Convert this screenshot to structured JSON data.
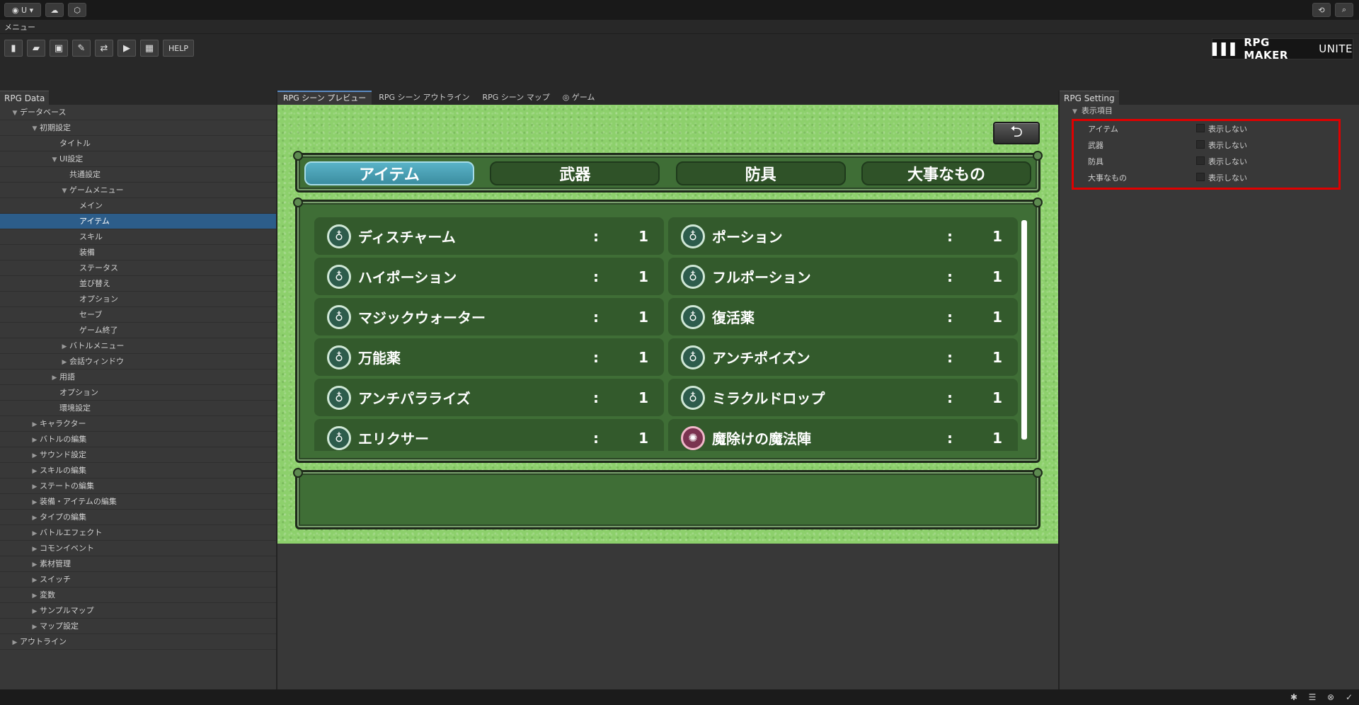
{
  "topbar": {
    "account_label": "U",
    "account_caret": "▾"
  },
  "menu": {
    "label": "メニュー"
  },
  "toolbar": {
    "help_label": "HELP",
    "logo_text": "RPG MAKER",
    "logo_suffix": "UNITE"
  },
  "left_panel": {
    "tab": "RPG Data",
    "tree": [
      {
        "label": "データベース",
        "depth": 0,
        "arrow": "down"
      },
      {
        "label": "初期設定",
        "depth": 2,
        "arrow": "down"
      },
      {
        "label": "タイトル",
        "depth": 4,
        "arrow": "none"
      },
      {
        "label": "UI設定",
        "depth": 4,
        "arrow": "down"
      },
      {
        "label": "共通設定",
        "depth": 5,
        "arrow": "none"
      },
      {
        "label": "ゲームメニュー",
        "depth": 5,
        "arrow": "down"
      },
      {
        "label": "メイン",
        "depth": 6,
        "arrow": "none"
      },
      {
        "label": "アイテム",
        "depth": 6,
        "arrow": "none",
        "selected": true
      },
      {
        "label": "スキル",
        "depth": 6,
        "arrow": "none"
      },
      {
        "label": "装備",
        "depth": 6,
        "arrow": "none"
      },
      {
        "label": "ステータス",
        "depth": 6,
        "arrow": "none"
      },
      {
        "label": "並び替え",
        "depth": 6,
        "arrow": "none"
      },
      {
        "label": "オプション",
        "depth": 6,
        "arrow": "none"
      },
      {
        "label": "セーブ",
        "depth": 6,
        "arrow": "none"
      },
      {
        "label": "ゲーム終了",
        "depth": 6,
        "arrow": "none"
      },
      {
        "label": "バトルメニュー",
        "depth": 5,
        "arrow": "right"
      },
      {
        "label": "会話ウィンドウ",
        "depth": 5,
        "arrow": "right"
      },
      {
        "label": "用語",
        "depth": 4,
        "arrow": "right"
      },
      {
        "label": "オプション",
        "depth": 4,
        "arrow": "none"
      },
      {
        "label": "環境設定",
        "depth": 4,
        "arrow": "none"
      },
      {
        "label": "キャラクター",
        "depth": 2,
        "arrow": "right"
      },
      {
        "label": "バトルの編集",
        "depth": 2,
        "arrow": "right"
      },
      {
        "label": "サウンド設定",
        "depth": 2,
        "arrow": "right"
      },
      {
        "label": "スキルの編集",
        "depth": 2,
        "arrow": "right"
      },
      {
        "label": "ステートの編集",
        "depth": 2,
        "arrow": "right"
      },
      {
        "label": "装備・アイテムの編集",
        "depth": 2,
        "arrow": "right"
      },
      {
        "label": "タイプの編集",
        "depth": 2,
        "arrow": "right"
      },
      {
        "label": "バトルエフェクト",
        "depth": 2,
        "arrow": "right"
      },
      {
        "label": "コモンイベント",
        "depth": 2,
        "arrow": "right"
      },
      {
        "label": "素材管理",
        "depth": 2,
        "arrow": "right"
      },
      {
        "label": "スイッチ",
        "depth": 2,
        "arrow": "right"
      },
      {
        "label": "変数",
        "depth": 2,
        "arrow": "right"
      },
      {
        "label": "サンプルマップ",
        "depth": 2,
        "arrow": "right"
      },
      {
        "label": "マップ設定",
        "depth": 2,
        "arrow": "right"
      },
      {
        "label": "アウトライン",
        "depth": 0,
        "arrow": "right"
      }
    ]
  },
  "center_tabs": [
    {
      "label": "RPG シーン プレビュー",
      "active": true
    },
    {
      "label": "RPG シーン アウトライン",
      "active": false
    },
    {
      "label": "RPG シーン マップ",
      "active": false
    },
    {
      "label": "ゲーム",
      "active": false,
      "icon": "gamepad-icon"
    }
  ],
  "game": {
    "back_glyph": "⮌",
    "categories": [
      {
        "label": "アイテム",
        "active": true
      },
      {
        "label": "武器",
        "active": false
      },
      {
        "label": "防具",
        "active": false
      },
      {
        "label": "大事なもの",
        "active": false
      }
    ],
    "items": [
      {
        "name": "ディスチャーム",
        "qty": "1",
        "icon": "potion-icon"
      },
      {
        "name": "ポーション",
        "qty": "1",
        "icon": "potion-icon"
      },
      {
        "name": "ハイポーション",
        "qty": "1",
        "icon": "potion-icon"
      },
      {
        "name": "フルポーション",
        "qty": "1",
        "icon": "potion-icon"
      },
      {
        "name": "マジックウォーター",
        "qty": "1",
        "icon": "potion-icon"
      },
      {
        "name": "復活薬",
        "qty": "1",
        "icon": "potion-icon"
      },
      {
        "name": "万能薬",
        "qty": "1",
        "icon": "potion-icon"
      },
      {
        "name": "アンチポイズン",
        "qty": "1",
        "icon": "potion-icon"
      },
      {
        "name": "アンチパラライズ",
        "qty": "1",
        "icon": "potion-icon"
      },
      {
        "name": "ミラクルドロップ",
        "qty": "1",
        "icon": "potion-icon"
      },
      {
        "name": "エリクサー",
        "qty": "1",
        "icon": "potion-icon"
      },
      {
        "name": "魔除けの魔法陣",
        "qty": "1",
        "icon": "magic-circle-icon"
      }
    ],
    "colon": ":"
  },
  "right_panel": {
    "tab": "RPG Setting",
    "section": "表示項目",
    "settings": [
      {
        "label": "アイテム",
        "value": "表示しない"
      },
      {
        "label": "武器",
        "value": "表示しない"
      },
      {
        "label": "防具",
        "value": "表示しない"
      },
      {
        "label": "大事なもの",
        "value": "表示しない"
      }
    ],
    "highlight_color": "#e00000"
  }
}
